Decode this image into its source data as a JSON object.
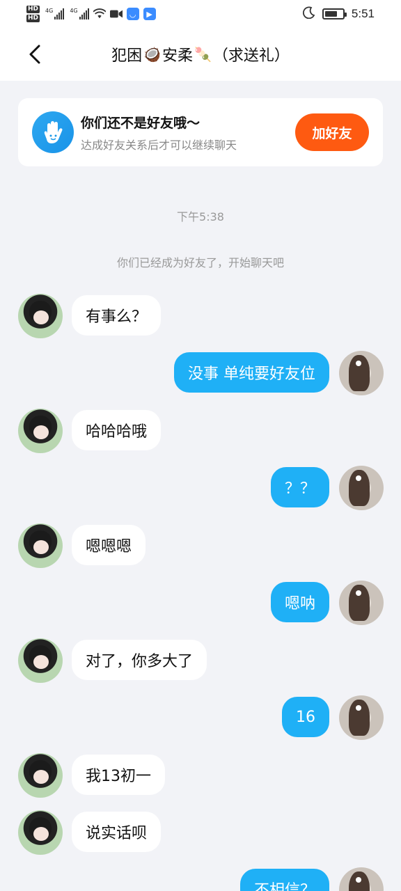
{
  "status_bar": {
    "hd1": "HD",
    "hd2": "HD",
    "net1": "4G",
    "net2": "4G",
    "time": "5:51"
  },
  "header": {
    "title_part1": "犯困",
    "emoji1": "🥥",
    "title_part2": "安柔",
    "emoji2": "🍡",
    "title_part3": "（求送礼）"
  },
  "banner": {
    "title": "你们还不是好友哦～",
    "subtitle": "达成好友关系后才可以继续聊天",
    "button": "加好友"
  },
  "timestamp": "下午5:38",
  "system_message": "你们已经成为好友了，开始聊天吧",
  "messages": [
    {
      "side": "them",
      "text": "有事么？"
    },
    {
      "side": "me",
      "text": "没事 单纯要好友位"
    },
    {
      "side": "them",
      "text": "哈哈哈哦"
    },
    {
      "side": "me",
      "text": "？？"
    },
    {
      "side": "them",
      "text": "嗯嗯嗯"
    },
    {
      "side": "me",
      "text": "嗯呐"
    },
    {
      "side": "them",
      "text": "对了，你多大了"
    },
    {
      "side": "me",
      "text": "16"
    },
    {
      "side": "them",
      "text": "我13初一"
    },
    {
      "side": "them",
      "text": "说实话呗"
    },
    {
      "side": "me",
      "text": "不相信？"
    }
  ],
  "colors": {
    "accent_blue": "#1fb0f6",
    "button_orange": "#fe5a11",
    "background": "#f2f3f7"
  }
}
